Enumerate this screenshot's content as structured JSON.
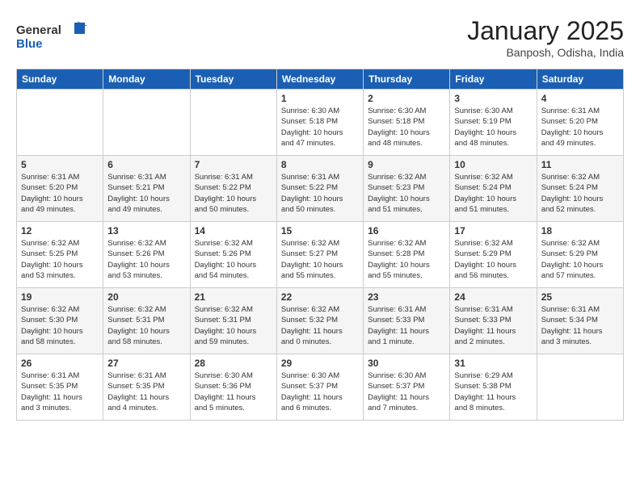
{
  "logo": {
    "general": "General",
    "blue": "Blue"
  },
  "header": {
    "title": "January 2025",
    "subtitle": "Banposh, Odisha, India"
  },
  "weekdays": [
    "Sunday",
    "Monday",
    "Tuesday",
    "Wednesday",
    "Thursday",
    "Friday",
    "Saturday"
  ],
  "weeks": [
    [
      {
        "day": "",
        "info": ""
      },
      {
        "day": "",
        "info": ""
      },
      {
        "day": "",
        "info": ""
      },
      {
        "day": "1",
        "info": "Sunrise: 6:30 AM\nSunset: 5:18 PM\nDaylight: 10 hours\nand 47 minutes."
      },
      {
        "day": "2",
        "info": "Sunrise: 6:30 AM\nSunset: 5:18 PM\nDaylight: 10 hours\nand 48 minutes."
      },
      {
        "day": "3",
        "info": "Sunrise: 6:30 AM\nSunset: 5:19 PM\nDaylight: 10 hours\nand 48 minutes."
      },
      {
        "day": "4",
        "info": "Sunrise: 6:31 AM\nSunset: 5:20 PM\nDaylight: 10 hours\nand 49 minutes."
      }
    ],
    [
      {
        "day": "5",
        "info": "Sunrise: 6:31 AM\nSunset: 5:20 PM\nDaylight: 10 hours\nand 49 minutes."
      },
      {
        "day": "6",
        "info": "Sunrise: 6:31 AM\nSunset: 5:21 PM\nDaylight: 10 hours\nand 49 minutes."
      },
      {
        "day": "7",
        "info": "Sunrise: 6:31 AM\nSunset: 5:22 PM\nDaylight: 10 hours\nand 50 minutes."
      },
      {
        "day": "8",
        "info": "Sunrise: 6:31 AM\nSunset: 5:22 PM\nDaylight: 10 hours\nand 50 minutes."
      },
      {
        "day": "9",
        "info": "Sunrise: 6:32 AM\nSunset: 5:23 PM\nDaylight: 10 hours\nand 51 minutes."
      },
      {
        "day": "10",
        "info": "Sunrise: 6:32 AM\nSunset: 5:24 PM\nDaylight: 10 hours\nand 51 minutes."
      },
      {
        "day": "11",
        "info": "Sunrise: 6:32 AM\nSunset: 5:24 PM\nDaylight: 10 hours\nand 52 minutes."
      }
    ],
    [
      {
        "day": "12",
        "info": "Sunrise: 6:32 AM\nSunset: 5:25 PM\nDaylight: 10 hours\nand 53 minutes."
      },
      {
        "day": "13",
        "info": "Sunrise: 6:32 AM\nSunset: 5:26 PM\nDaylight: 10 hours\nand 53 minutes."
      },
      {
        "day": "14",
        "info": "Sunrise: 6:32 AM\nSunset: 5:26 PM\nDaylight: 10 hours\nand 54 minutes."
      },
      {
        "day": "15",
        "info": "Sunrise: 6:32 AM\nSunset: 5:27 PM\nDaylight: 10 hours\nand 55 minutes."
      },
      {
        "day": "16",
        "info": "Sunrise: 6:32 AM\nSunset: 5:28 PM\nDaylight: 10 hours\nand 55 minutes."
      },
      {
        "day": "17",
        "info": "Sunrise: 6:32 AM\nSunset: 5:29 PM\nDaylight: 10 hours\nand 56 minutes."
      },
      {
        "day": "18",
        "info": "Sunrise: 6:32 AM\nSunset: 5:29 PM\nDaylight: 10 hours\nand 57 minutes."
      }
    ],
    [
      {
        "day": "19",
        "info": "Sunrise: 6:32 AM\nSunset: 5:30 PM\nDaylight: 10 hours\nand 58 minutes."
      },
      {
        "day": "20",
        "info": "Sunrise: 6:32 AM\nSunset: 5:31 PM\nDaylight: 10 hours\nand 58 minutes."
      },
      {
        "day": "21",
        "info": "Sunrise: 6:32 AM\nSunset: 5:31 PM\nDaylight: 10 hours\nand 59 minutes."
      },
      {
        "day": "22",
        "info": "Sunrise: 6:32 AM\nSunset: 5:32 PM\nDaylight: 11 hours\nand 0 minutes."
      },
      {
        "day": "23",
        "info": "Sunrise: 6:31 AM\nSunset: 5:33 PM\nDaylight: 11 hours\nand 1 minute."
      },
      {
        "day": "24",
        "info": "Sunrise: 6:31 AM\nSunset: 5:33 PM\nDaylight: 11 hours\nand 2 minutes."
      },
      {
        "day": "25",
        "info": "Sunrise: 6:31 AM\nSunset: 5:34 PM\nDaylight: 11 hours\nand 3 minutes."
      }
    ],
    [
      {
        "day": "26",
        "info": "Sunrise: 6:31 AM\nSunset: 5:35 PM\nDaylight: 11 hours\nand 3 minutes."
      },
      {
        "day": "27",
        "info": "Sunrise: 6:31 AM\nSunset: 5:35 PM\nDaylight: 11 hours\nand 4 minutes."
      },
      {
        "day": "28",
        "info": "Sunrise: 6:30 AM\nSunset: 5:36 PM\nDaylight: 11 hours\nand 5 minutes."
      },
      {
        "day": "29",
        "info": "Sunrise: 6:30 AM\nSunset: 5:37 PM\nDaylight: 11 hours\nand 6 minutes."
      },
      {
        "day": "30",
        "info": "Sunrise: 6:30 AM\nSunset: 5:37 PM\nDaylight: 11 hours\nand 7 minutes."
      },
      {
        "day": "31",
        "info": "Sunrise: 6:29 AM\nSunset: 5:38 PM\nDaylight: 11 hours\nand 8 minutes."
      },
      {
        "day": "",
        "info": ""
      }
    ]
  ]
}
